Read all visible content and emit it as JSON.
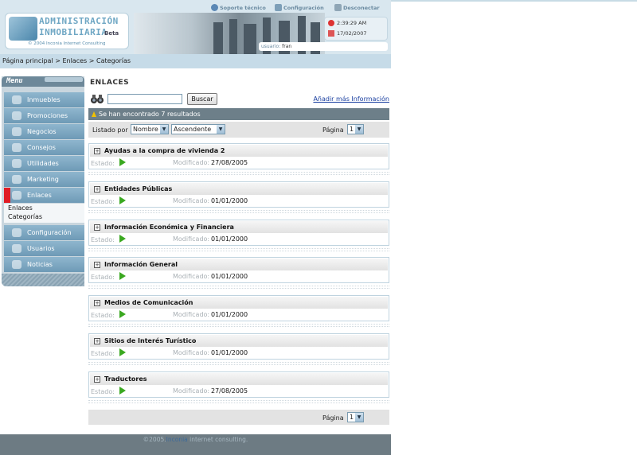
{
  "header": {
    "logo_line1": "ADMINISTRACIÓN",
    "logo_line2": "INMOBILIARIA",
    "logo_beta": "Beta",
    "logo_copyright": "© 2004 Inconia Internet Consulting",
    "top_links": [
      "Soporte técnico",
      "Configuración",
      "Desconectar"
    ],
    "time": "2:39:29 AM",
    "date": "17/02/2007",
    "user_label": "usuario:",
    "user_name": "fran"
  },
  "breadcrumb": "Página principal > Enlaces >  Categorías",
  "sidebar": {
    "title": "Menu",
    "items": [
      {
        "label": "Inmuebles",
        "icon": "house-icon"
      },
      {
        "label": "Promociones",
        "icon": "promo-icon"
      },
      {
        "label": "Negocios",
        "icon": "business-icon"
      },
      {
        "label": "Consejos",
        "icon": "advice-icon"
      },
      {
        "label": "Utilidades",
        "icon": "tools-icon"
      },
      {
        "label": "Marketing",
        "icon": "marketing-icon"
      },
      {
        "label": "Enlaces",
        "icon": "links-icon"
      },
      {
        "label": "Configuración",
        "icon": "gears-icon"
      },
      {
        "label": "Usuarios",
        "icon": "users-icon"
      },
      {
        "label": "Noticias",
        "icon": "news-icon"
      }
    ],
    "active": "Enlaces",
    "submenu": [
      "Enlaces",
      "Categorías"
    ]
  },
  "main": {
    "title": "ENLACES",
    "search_button": "Buscar",
    "search_value": "",
    "add_link": "Añadir más Información",
    "results_text": "Se han encontrado 7 resultados",
    "sort_label": "Listado por",
    "sort_field": "Nombre",
    "sort_order": "Ascendente",
    "page_label": "Página",
    "page_value": "1",
    "estado_label": "Estado:",
    "modified_label": "Modificado:",
    "items": [
      {
        "title": "Ayudas a la compra de vivienda 2",
        "modified": "27/08/2005"
      },
      {
        "title": "Entidades Públicas",
        "modified": "01/01/2000"
      },
      {
        "title": "Información Económica y Financiera",
        "modified": "01/01/2000"
      },
      {
        "title": "Información General",
        "modified": "01/01/2000"
      },
      {
        "title": "Medios de Comunicación",
        "modified": "01/01/2000"
      },
      {
        "title": "Sitios de Interés Turístico",
        "modified": "01/01/2000"
      },
      {
        "title": "Traductores",
        "modified": "27/08/2005"
      }
    ]
  },
  "footer": {
    "prefix": "©2005.",
    "brand": "Inconia",
    "suffix": " internet consulting."
  },
  "colors": {
    "accent": "#6fa7c4",
    "menu_item": "#7fa8c2",
    "active_marker": "#e01c25",
    "results_bar": "#6d7f89",
    "status_play": "#3aa820"
  }
}
